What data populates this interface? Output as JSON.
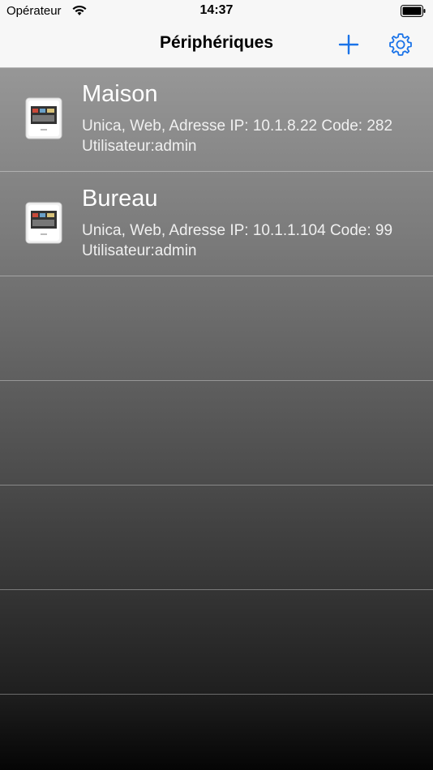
{
  "status_bar": {
    "carrier": "Opérateur",
    "time": "14:37",
    "icons": [
      "wifi-icon",
      "battery-icon"
    ]
  },
  "nav": {
    "title": "Périphériques",
    "add_icon": "plus-icon",
    "settings_icon": "gear-icon",
    "accent_color": "#1a73e8"
  },
  "devices": [
    {
      "name": "Maison",
      "details_line1": "Unica, Web, Adresse IP: 10.1.8.22 Code: 282",
      "details_line2": "Utilisateur:admin"
    },
    {
      "name": "Bureau",
      "details_line1": "Unica, Web, Adresse IP: 10.1.1.104 Code: 99",
      "details_line2": "Utilisateur:admin"
    }
  ]
}
